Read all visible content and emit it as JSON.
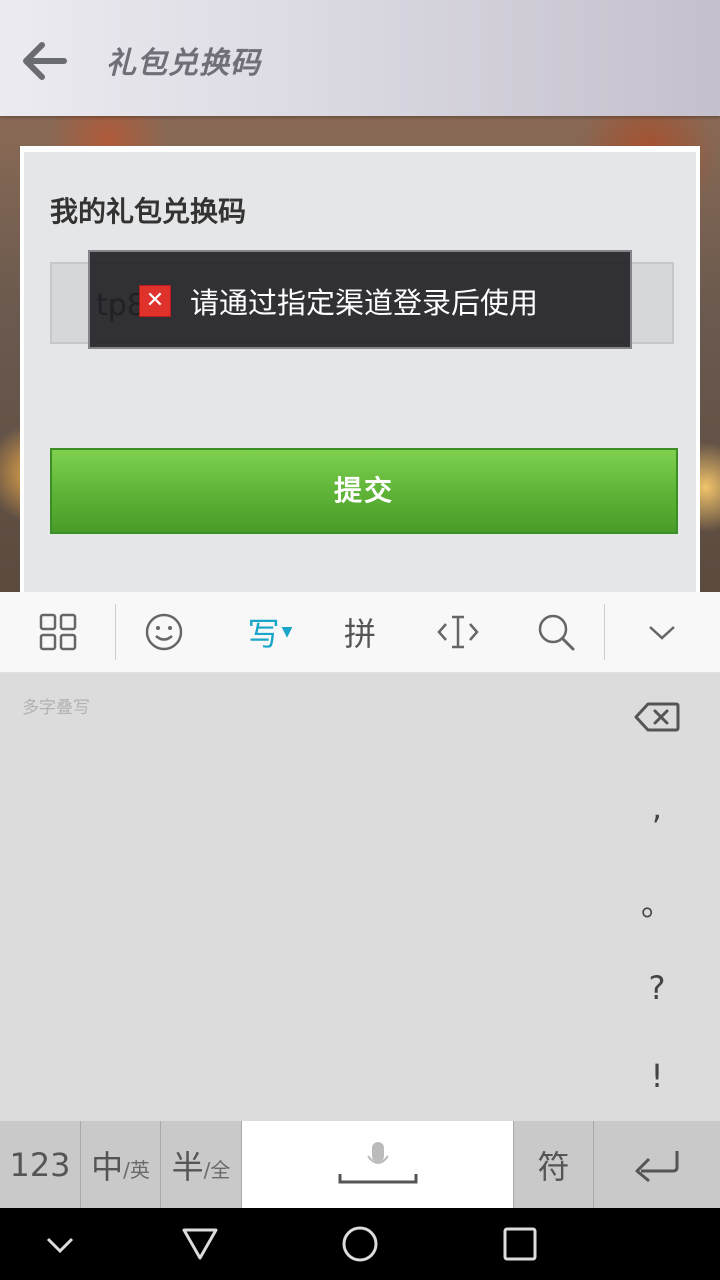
{
  "header": {
    "title": "礼包兑换码",
    "back_icon": "arrow-left-icon"
  },
  "panel": {
    "title": "我的礼包兑换码",
    "code_value": "tp8",
    "submit_label": "提交"
  },
  "toast": {
    "message": "请通过指定渠道登录后使用",
    "icon": "error-x-icon",
    "icon_color": "#e0322d"
  },
  "keyboard_toolbar": {
    "items": [
      {
        "name": "grid-menu-icon"
      },
      {
        "name": "emoji-icon"
      },
      {
        "label": "写",
        "name": "handwriting-mode"
      },
      {
        "label": "拼",
        "name": "pinyin-mode"
      },
      {
        "name": "cursor-edit-icon"
      },
      {
        "name": "search-icon"
      },
      {
        "name": "collapse-keyboard-icon"
      }
    ],
    "active_color": "#1aa6c9"
  },
  "handwriting": {
    "hint": "多字叠写",
    "side_keys": [
      ",",
      "。",
      "?",
      "!"
    ]
  },
  "keyboard_row": {
    "num_key": "123",
    "lang_main": "中",
    "lang_sub": "/英",
    "width_main": "半",
    "width_sub": "/全",
    "symbol_key": "符"
  },
  "colors": {
    "submit_green": "#5db236",
    "accent": "#1aa6c9"
  }
}
